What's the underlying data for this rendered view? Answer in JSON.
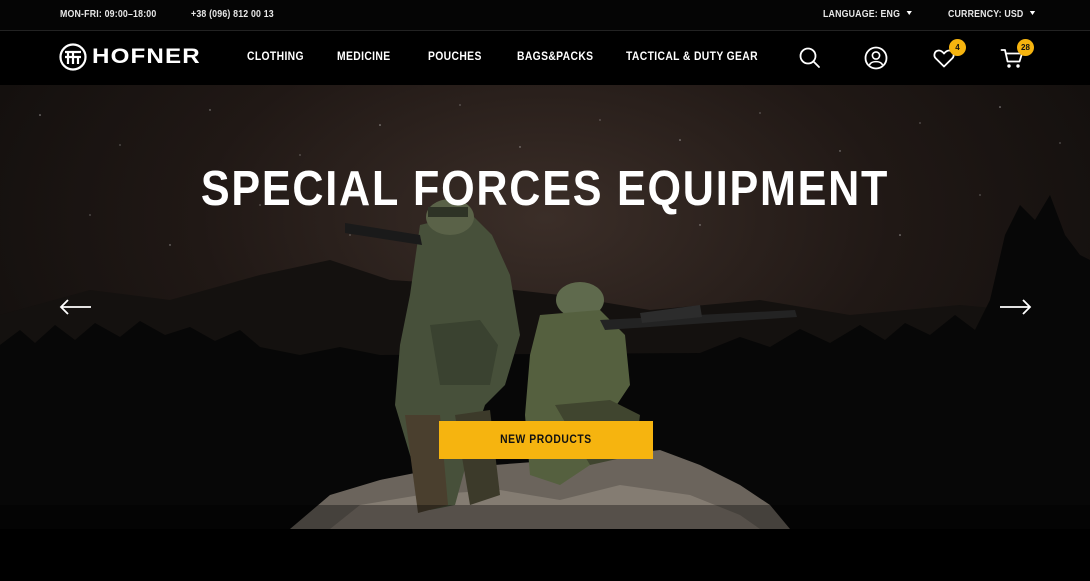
{
  "topbar": {
    "hours": "MON-FRI: 09:00–18:00",
    "phone": "+38 (096) 812 00 13",
    "language": "LANGUAGE: ENG",
    "currency": "CURRENCY: USD"
  },
  "brand": {
    "name": "HOFNER"
  },
  "nav": {
    "items": [
      {
        "label": "CLOTHING"
      },
      {
        "label": "MEDICINE"
      },
      {
        "label": "POUCHES"
      },
      {
        "label": "BAGS&PACKS"
      },
      {
        "label": "TACTICAL & DUTY GEAR"
      }
    ],
    "wishlist_count": "4",
    "cart_count": "28"
  },
  "hero": {
    "title": "SPECIAL FORCES EQUIPMENT",
    "cta_label": "NEW PRODUCTS"
  },
  "colors": {
    "accent": "#f6b40f",
    "background": "#000000"
  },
  "icons": [
    "hofner-logo-icon",
    "search-icon",
    "user-icon",
    "heart-icon",
    "cart-icon",
    "arrow-left-icon",
    "arrow-right-icon",
    "caret-down-icon"
  ]
}
